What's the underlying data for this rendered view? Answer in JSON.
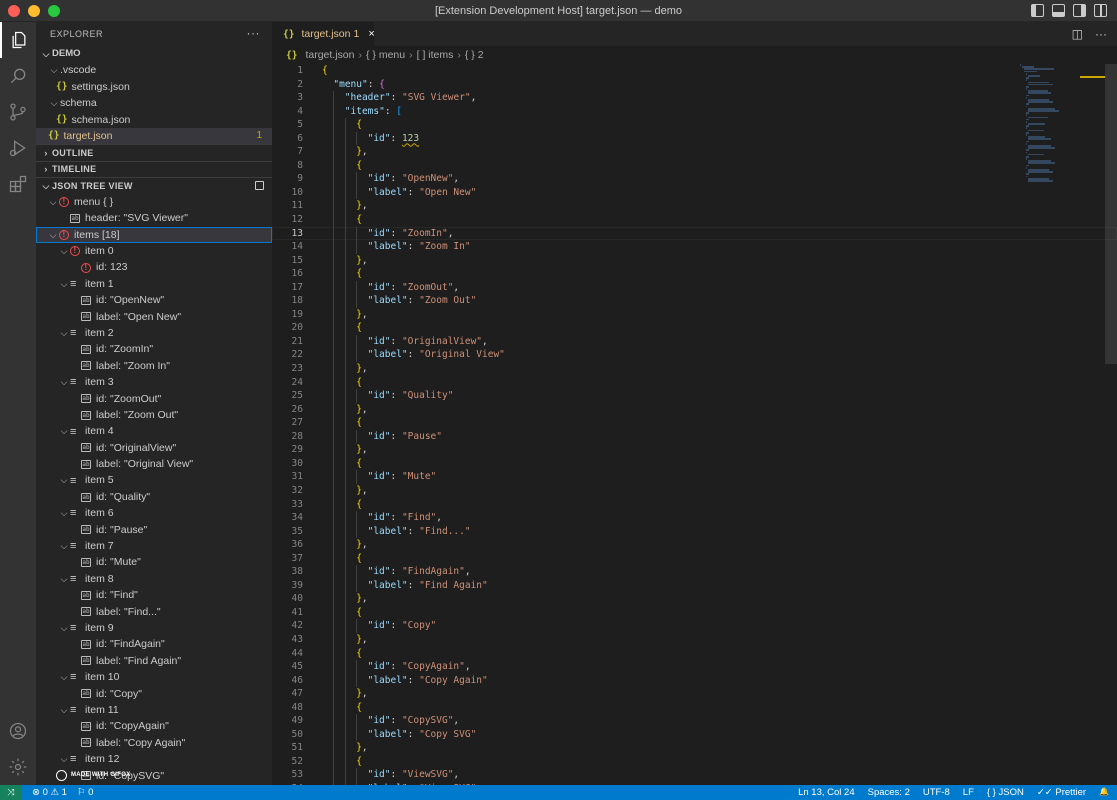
{
  "window": {
    "title": "[Extension Development Host] target.json — demo"
  },
  "sidebar": {
    "title": "EXPLORER",
    "more": "···",
    "explorer": {
      "root": "DEMO",
      "items": [
        {
          "label": ".vscode",
          "depth": 1,
          "kind": "folder"
        },
        {
          "label": "settings.json",
          "depth": 2,
          "kind": "json"
        },
        {
          "label": "schema",
          "depth": 1,
          "kind": "folder"
        },
        {
          "label": "schema.json",
          "depth": 2,
          "kind": "json"
        },
        {
          "label": "target.json",
          "depth": 1,
          "kind": "json",
          "active": true,
          "badge": "1"
        }
      ]
    },
    "sections": {
      "outline": "OUTLINE",
      "timeline": "TIMELINE",
      "json_tree": "JSON TREE VIEW"
    },
    "tree": [
      {
        "label": "menu { }",
        "depth": 1,
        "icon": "error",
        "chev": "open"
      },
      {
        "label": "header: \"SVG Viewer\"",
        "depth": 2,
        "icon": "string"
      },
      {
        "label": "items [18]",
        "depth": 1,
        "icon": "error",
        "chev": "open",
        "selected": true
      },
      {
        "label": "item 0",
        "depth": 2,
        "icon": "error",
        "chev": "open"
      },
      {
        "label": "id: 123",
        "depth": 3,
        "icon": "error"
      },
      {
        "label": "item 1",
        "depth": 2,
        "icon": "list",
        "chev": "open"
      },
      {
        "label": "id: \"OpenNew\"",
        "depth": 3,
        "icon": "string"
      },
      {
        "label": "label: \"Open New\"",
        "depth": 3,
        "icon": "string"
      },
      {
        "label": "item 2",
        "depth": 2,
        "icon": "list",
        "chev": "open"
      },
      {
        "label": "id: \"ZoomIn\"",
        "depth": 3,
        "icon": "string"
      },
      {
        "label": "label: \"Zoom In\"",
        "depth": 3,
        "icon": "string"
      },
      {
        "label": "item 3",
        "depth": 2,
        "icon": "list",
        "chev": "open"
      },
      {
        "label": "id: \"ZoomOut\"",
        "depth": 3,
        "icon": "string"
      },
      {
        "label": "label: \"Zoom Out\"",
        "depth": 3,
        "icon": "string"
      },
      {
        "label": "item 4",
        "depth": 2,
        "icon": "list",
        "chev": "open"
      },
      {
        "label": "id: \"OriginalView\"",
        "depth": 3,
        "icon": "string"
      },
      {
        "label": "label: \"Original View\"",
        "depth": 3,
        "icon": "string"
      },
      {
        "label": "item 5",
        "depth": 2,
        "icon": "list",
        "chev": "open"
      },
      {
        "label": "id: \"Quality\"",
        "depth": 3,
        "icon": "string"
      },
      {
        "label": "item 6",
        "depth": 2,
        "icon": "list",
        "chev": "open"
      },
      {
        "label": "id: \"Pause\"",
        "depth": 3,
        "icon": "string"
      },
      {
        "label": "item 7",
        "depth": 2,
        "icon": "list",
        "chev": "open"
      },
      {
        "label": "id: \"Mute\"",
        "depth": 3,
        "icon": "string"
      },
      {
        "label": "item 8",
        "depth": 2,
        "icon": "list",
        "chev": "open"
      },
      {
        "label": "id: \"Find\"",
        "depth": 3,
        "icon": "string"
      },
      {
        "label": "label: \"Find...\"",
        "depth": 3,
        "icon": "string"
      },
      {
        "label": "item 9",
        "depth": 2,
        "icon": "list",
        "chev": "open"
      },
      {
        "label": "id: \"FindAgain\"",
        "depth": 3,
        "icon": "string"
      },
      {
        "label": "label: \"Find Again\"",
        "depth": 3,
        "icon": "string"
      },
      {
        "label": "item 10",
        "depth": 2,
        "icon": "list",
        "chev": "open"
      },
      {
        "label": "id: \"Copy\"",
        "depth": 3,
        "icon": "string"
      },
      {
        "label": "item 11",
        "depth": 2,
        "icon": "list",
        "chev": "open"
      },
      {
        "label": "id: \"CopyAgain\"",
        "depth": 3,
        "icon": "string"
      },
      {
        "label": "label: \"Copy Again\"",
        "depth": 3,
        "icon": "string"
      },
      {
        "label": "item 12",
        "depth": 2,
        "icon": "list",
        "chev": "open"
      },
      {
        "label": "id: \"CopySVG\"",
        "depth": 3,
        "icon": "string"
      }
    ],
    "watermark": "MADE WITH GIFOX"
  },
  "editor": {
    "tab": {
      "label": "target.json",
      "badge": "1",
      "close": "×"
    },
    "breadcrumb": [
      "target.json",
      "{ } menu",
      "[ ] items",
      "{ } 2"
    ],
    "current_line": 13,
    "lines": [
      {
        "n": 1,
        "i": 0,
        "t": [
          [
            "b1",
            "{"
          ]
        ]
      },
      {
        "n": 2,
        "i": 1,
        "t": [
          [
            "k",
            "\"menu\""
          ],
          [
            "p",
            ": "
          ],
          [
            "b2",
            "{"
          ]
        ]
      },
      {
        "n": 3,
        "i": 2,
        "t": [
          [
            "k",
            "\"header\""
          ],
          [
            "p",
            ": "
          ],
          [
            "s",
            "\"SVG Viewer\""
          ],
          [
            "p",
            ","
          ]
        ]
      },
      {
        "n": 4,
        "i": 2,
        "t": [
          [
            "k",
            "\"items\""
          ],
          [
            "p",
            ": "
          ],
          [
            "b3",
            "["
          ]
        ]
      },
      {
        "n": 5,
        "i": 3,
        "t": [
          [
            "b1",
            "{"
          ]
        ]
      },
      {
        "n": 6,
        "i": 4,
        "t": [
          [
            "k",
            "\"id\""
          ],
          [
            "p",
            ": "
          ],
          [
            "n",
            "123"
          ]
        ]
      },
      {
        "n": 7,
        "i": 3,
        "t": [
          [
            "b1",
            "}"
          ],
          [
            "p",
            ","
          ]
        ]
      },
      {
        "n": 8,
        "i": 3,
        "t": [
          [
            "b1",
            "{"
          ]
        ]
      },
      {
        "n": 9,
        "i": 4,
        "t": [
          [
            "k",
            "\"id\""
          ],
          [
            "p",
            ": "
          ],
          [
            "s",
            "\"OpenNew\""
          ],
          [
            "p",
            ","
          ]
        ]
      },
      {
        "n": 10,
        "i": 4,
        "t": [
          [
            "k",
            "\"label\""
          ],
          [
            "p",
            ": "
          ],
          [
            "s",
            "\"Open New\""
          ]
        ]
      },
      {
        "n": 11,
        "i": 3,
        "t": [
          [
            "b1",
            "}"
          ],
          [
            "p",
            ","
          ]
        ]
      },
      {
        "n": 12,
        "i": 3,
        "t": [
          [
            "b1",
            "{"
          ]
        ]
      },
      {
        "n": 13,
        "i": 4,
        "t": [
          [
            "k",
            "\"id\""
          ],
          [
            "p",
            ": "
          ],
          [
            "s",
            "\"ZoomIn\""
          ],
          [
            "p",
            ","
          ]
        ]
      },
      {
        "n": 14,
        "i": 4,
        "t": [
          [
            "k",
            "\"label\""
          ],
          [
            "p",
            ": "
          ],
          [
            "s",
            "\"Zoom In\""
          ]
        ]
      },
      {
        "n": 15,
        "i": 3,
        "t": [
          [
            "b1",
            "}"
          ],
          [
            "p",
            ","
          ]
        ]
      },
      {
        "n": 16,
        "i": 3,
        "t": [
          [
            "b1",
            "{"
          ]
        ]
      },
      {
        "n": 17,
        "i": 4,
        "t": [
          [
            "k",
            "\"id\""
          ],
          [
            "p",
            ": "
          ],
          [
            "s",
            "\"ZoomOut\""
          ],
          [
            "p",
            ","
          ]
        ]
      },
      {
        "n": 18,
        "i": 4,
        "t": [
          [
            "k",
            "\"label\""
          ],
          [
            "p",
            ": "
          ],
          [
            "s",
            "\"Zoom Out\""
          ]
        ]
      },
      {
        "n": 19,
        "i": 3,
        "t": [
          [
            "b1",
            "}"
          ],
          [
            "p",
            ","
          ]
        ]
      },
      {
        "n": 20,
        "i": 3,
        "t": [
          [
            "b1",
            "{"
          ]
        ]
      },
      {
        "n": 21,
        "i": 4,
        "t": [
          [
            "k",
            "\"id\""
          ],
          [
            "p",
            ": "
          ],
          [
            "s",
            "\"OriginalView\""
          ],
          [
            "p",
            ","
          ]
        ]
      },
      {
        "n": 22,
        "i": 4,
        "t": [
          [
            "k",
            "\"label\""
          ],
          [
            "p",
            ": "
          ],
          [
            "s",
            "\"Original View\""
          ]
        ]
      },
      {
        "n": 23,
        "i": 3,
        "t": [
          [
            "b1",
            "}"
          ],
          [
            "p",
            ","
          ]
        ]
      },
      {
        "n": 24,
        "i": 3,
        "t": [
          [
            "b1",
            "{"
          ]
        ]
      },
      {
        "n": 25,
        "i": 4,
        "t": [
          [
            "k",
            "\"id\""
          ],
          [
            "p",
            ": "
          ],
          [
            "s",
            "\"Quality\""
          ]
        ]
      },
      {
        "n": 26,
        "i": 3,
        "t": [
          [
            "b1",
            "}"
          ],
          [
            "p",
            ","
          ]
        ]
      },
      {
        "n": 27,
        "i": 3,
        "t": [
          [
            "b1",
            "{"
          ]
        ]
      },
      {
        "n": 28,
        "i": 4,
        "t": [
          [
            "k",
            "\"id\""
          ],
          [
            "p",
            ": "
          ],
          [
            "s",
            "\"Pause\""
          ]
        ]
      },
      {
        "n": 29,
        "i": 3,
        "t": [
          [
            "b1",
            "}"
          ],
          [
            "p",
            ","
          ]
        ]
      },
      {
        "n": 30,
        "i": 3,
        "t": [
          [
            "b1",
            "{"
          ]
        ]
      },
      {
        "n": 31,
        "i": 4,
        "t": [
          [
            "k",
            "\"id\""
          ],
          [
            "p",
            ": "
          ],
          [
            "s",
            "\"Mute\""
          ]
        ]
      },
      {
        "n": 32,
        "i": 3,
        "t": [
          [
            "b1",
            "}"
          ],
          [
            "p",
            ","
          ]
        ]
      },
      {
        "n": 33,
        "i": 3,
        "t": [
          [
            "b1",
            "{"
          ]
        ]
      },
      {
        "n": 34,
        "i": 4,
        "t": [
          [
            "k",
            "\"id\""
          ],
          [
            "p",
            ": "
          ],
          [
            "s",
            "\"Find\""
          ],
          [
            "p",
            ","
          ]
        ]
      },
      {
        "n": 35,
        "i": 4,
        "t": [
          [
            "k",
            "\"label\""
          ],
          [
            "p",
            ": "
          ],
          [
            "s",
            "\"Find...\""
          ]
        ]
      },
      {
        "n": 36,
        "i": 3,
        "t": [
          [
            "b1",
            "}"
          ],
          [
            "p",
            ","
          ]
        ]
      },
      {
        "n": 37,
        "i": 3,
        "t": [
          [
            "b1",
            "{"
          ]
        ]
      },
      {
        "n": 38,
        "i": 4,
        "t": [
          [
            "k",
            "\"id\""
          ],
          [
            "p",
            ": "
          ],
          [
            "s",
            "\"FindAgain\""
          ],
          [
            "p",
            ","
          ]
        ]
      },
      {
        "n": 39,
        "i": 4,
        "t": [
          [
            "k",
            "\"label\""
          ],
          [
            "p",
            ": "
          ],
          [
            "s",
            "\"Find Again\""
          ]
        ]
      },
      {
        "n": 40,
        "i": 3,
        "t": [
          [
            "b1",
            "}"
          ],
          [
            "p",
            ","
          ]
        ]
      },
      {
        "n": 41,
        "i": 3,
        "t": [
          [
            "b1",
            "{"
          ]
        ]
      },
      {
        "n": 42,
        "i": 4,
        "t": [
          [
            "k",
            "\"id\""
          ],
          [
            "p",
            ": "
          ],
          [
            "s",
            "\"Copy\""
          ]
        ]
      },
      {
        "n": 43,
        "i": 3,
        "t": [
          [
            "b1",
            "}"
          ],
          [
            "p",
            ","
          ]
        ]
      },
      {
        "n": 44,
        "i": 3,
        "t": [
          [
            "b1",
            "{"
          ]
        ]
      },
      {
        "n": 45,
        "i": 4,
        "t": [
          [
            "k",
            "\"id\""
          ],
          [
            "p",
            ": "
          ],
          [
            "s",
            "\"CopyAgain\""
          ],
          [
            "p",
            ","
          ]
        ]
      },
      {
        "n": 46,
        "i": 4,
        "t": [
          [
            "k",
            "\"label\""
          ],
          [
            "p",
            ": "
          ],
          [
            "s",
            "\"Copy Again\""
          ]
        ]
      },
      {
        "n": 47,
        "i": 3,
        "t": [
          [
            "b1",
            "}"
          ],
          [
            "p",
            ","
          ]
        ]
      },
      {
        "n": 48,
        "i": 3,
        "t": [
          [
            "b1",
            "{"
          ]
        ]
      },
      {
        "n": 49,
        "i": 4,
        "t": [
          [
            "k",
            "\"id\""
          ],
          [
            "p",
            ": "
          ],
          [
            "s",
            "\"CopySVG\""
          ],
          [
            "p",
            ","
          ]
        ]
      },
      {
        "n": 50,
        "i": 4,
        "t": [
          [
            "k",
            "\"label\""
          ],
          [
            "p",
            ": "
          ],
          [
            "s",
            "\"Copy SVG\""
          ]
        ]
      },
      {
        "n": 51,
        "i": 3,
        "t": [
          [
            "b1",
            "}"
          ],
          [
            "p",
            ","
          ]
        ]
      },
      {
        "n": 52,
        "i": 3,
        "t": [
          [
            "b1",
            "{"
          ]
        ]
      },
      {
        "n": 53,
        "i": 4,
        "t": [
          [
            "k",
            "\"id\""
          ],
          [
            "p",
            ": "
          ],
          [
            "s",
            "\"ViewSVG\""
          ],
          [
            "p",
            ","
          ]
        ]
      },
      {
        "n": 54,
        "i": 4,
        "t": [
          [
            "k",
            "\"label\""
          ],
          [
            "p",
            ": "
          ],
          [
            "s",
            "\"View SVG\""
          ]
        ]
      }
    ]
  },
  "statusbar": {
    "remote": "⤨",
    "problems": "⊗ 0 ⚠ 1",
    "ports": "⚐ 0",
    "position": "Ln 13, Col 24",
    "spaces": "Spaces: 2",
    "encoding": "UTF-8",
    "eol": "LF",
    "language": "{ } JSON",
    "formatter": "✓✓ Prettier",
    "bell": "🔔"
  },
  "colors": {
    "accent": "#007acc",
    "error": "#f14c4c",
    "warning": "#cca700"
  }
}
